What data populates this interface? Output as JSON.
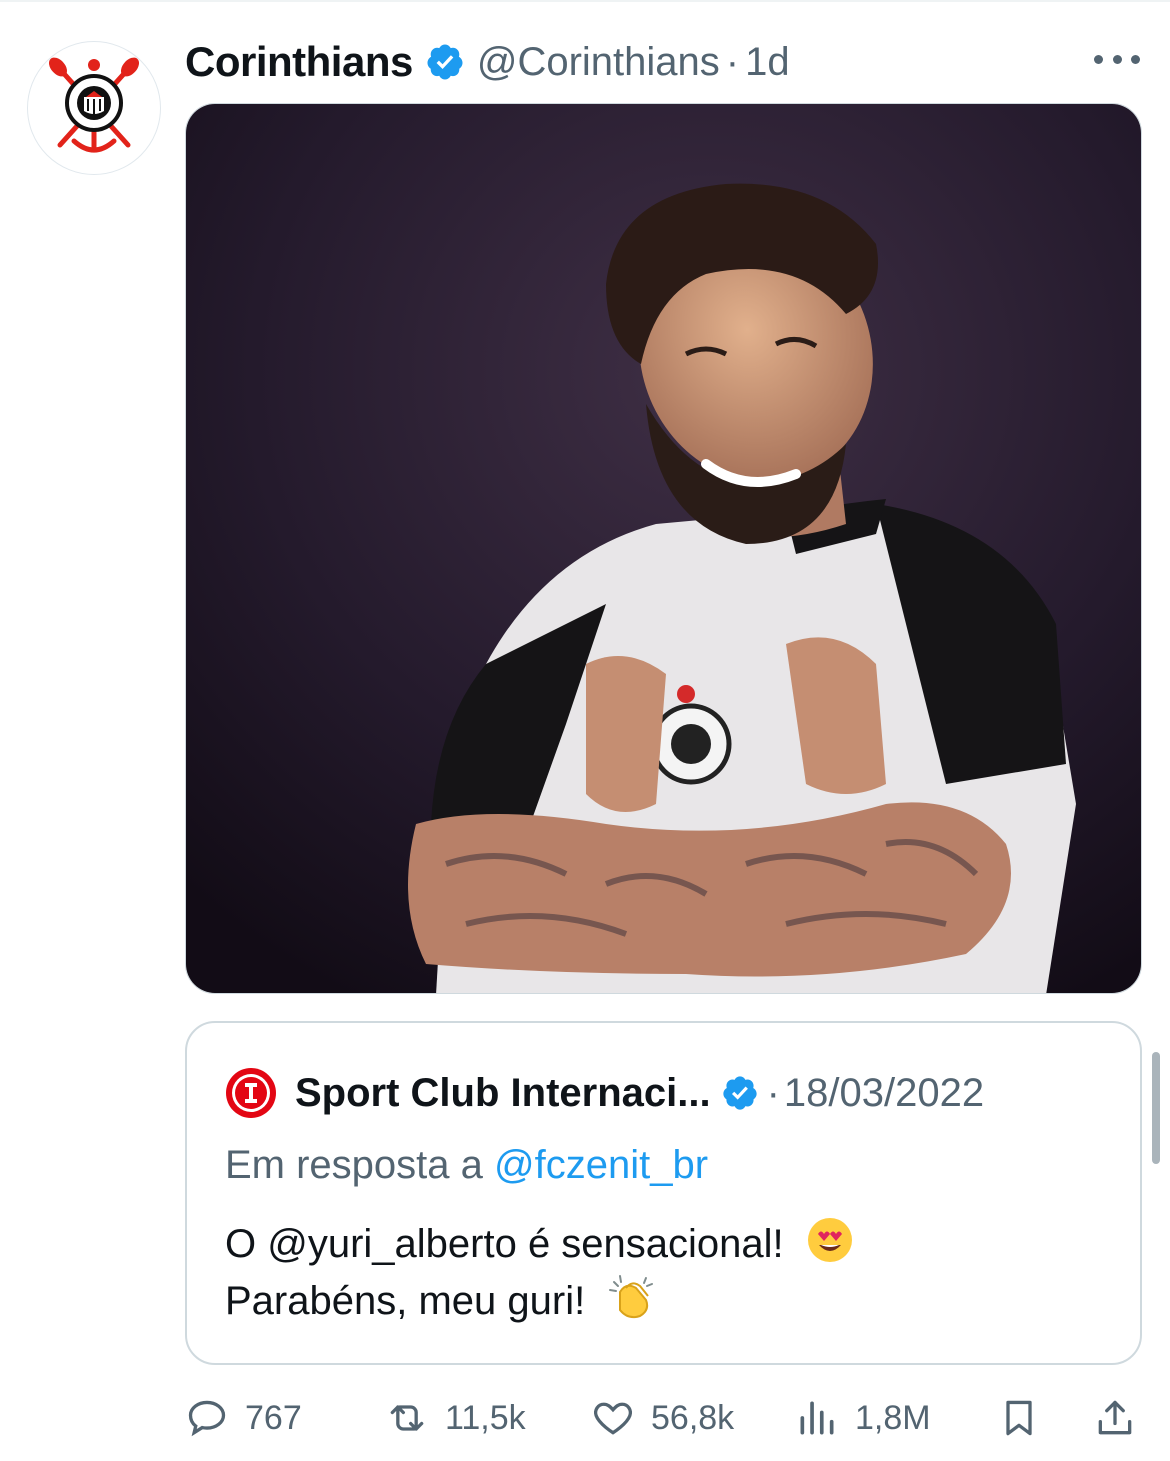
{
  "tweet": {
    "display_name": "Corinthians",
    "handle": "@Corinthians",
    "separator": "·",
    "time": "1d",
    "verified": true,
    "avatar_icon": "corinthians-crest-icon",
    "more_icon": "more-icon"
  },
  "quote": {
    "display_name": "Sport Club Internaci...",
    "separator": "·",
    "date": "18/03/2022",
    "verified": true,
    "avatar_icon": "internacional-crest-icon",
    "reply_prefix": "Em resposta a",
    "reply_handle": "@fczenit_br",
    "text_line1": "O @yuri_alberto é sensacional!",
    "text_line2": "Parabéns, meu guri!",
    "emoji1": "heart-eyes-emoji",
    "emoji2": "clapping-hands-emoji"
  },
  "actions": {
    "replies": "767",
    "retweets": "11,5k",
    "likes": "56,8k",
    "views": "1,8M"
  },
  "colors": {
    "accent": "#1d9bf0",
    "secondary_text": "#536471",
    "border": "#cfd9de",
    "corinthians_red": "#e2231a",
    "internacional_red": "#e30613"
  }
}
